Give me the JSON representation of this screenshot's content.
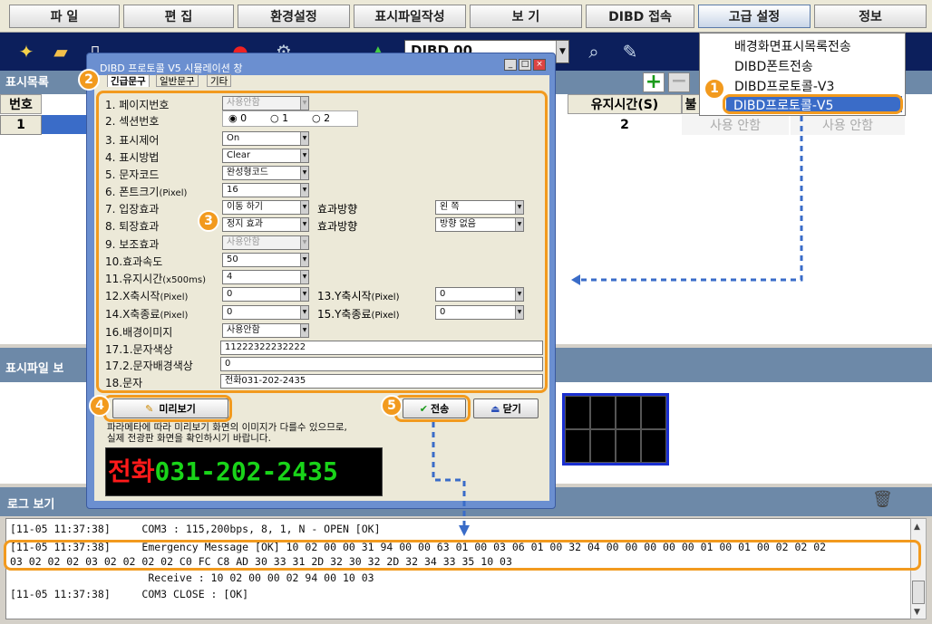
{
  "menubar": [
    "파 일",
    "편 집",
    "환경설정",
    "표시파일작성",
    "보 기",
    "DIBD 접속",
    "고급 설정",
    "정보"
  ],
  "toolbar": {
    "combo_value": "DIBD 00"
  },
  "list": {
    "title": "표시목록",
    "col_no": "번호",
    "col_hold": "유지시간(S)",
    "col_trunc": "불",
    "row_no": "1",
    "row_hold": "2",
    "unused_1": "사용 안함",
    "unused_2": "사용 안함"
  },
  "advanced_menu": [
    "배경화면표시목록전송",
    "DIBD폰트전송",
    "DIBD프로토콜-V3",
    "DIBD프로토콜-V5"
  ],
  "dialog": {
    "title": "DIBD 프로토콜 V5 시뮬레이션 창",
    "tabs": [
      "긴급문구",
      "일반문구",
      "기타"
    ],
    "labels": {
      "page": "1. 페이지번호",
      "section": "2. 섹션번호",
      "display_control": "3. 표시제어",
      "display_method": "4. 표시방법",
      "char_code": "5. 문자코드",
      "font_size": "6. 폰트크기",
      "font_size_unit": "(Pixel)",
      "enter_effect": "7. 입장효과",
      "exit_effect": "8. 퇴장효과",
      "aux_effect": "9. 보조효과",
      "effect_speed": "10.효과속도",
      "hold_time": "11.유지시간",
      "hold_unit": "(x500ms)",
      "x_start": "12.X축시작",
      "x_end": "14.X축종료",
      "px": "(Pixel)",
      "y_start": "13.Y축시작",
      "y_end": "15.Y축종료",
      "bg_image": "16.배경이미지",
      "text_color": "17.1.문자색상",
      "text_bg_color": "17.2.문자배경색상",
      "text": "18.문자",
      "effect_dir": "효과방향"
    },
    "values": {
      "page": "사용안함",
      "display_control": "On",
      "display_method": "Clear",
      "char_code": "완성형코드",
      "font_size": "16",
      "enter_effect": "이동 하기",
      "enter_dir": "왼     쪽",
      "exit_effect": "정지 효과",
      "exit_dir": "방향 없음",
      "aux_effect": "사용안함",
      "effect_speed": "50",
      "hold_time": "4",
      "x_start": "0",
      "x_end": "0",
      "y_start": "0",
      "y_end": "0",
      "bg_image": "사용안함",
      "text_color": "11222322232222",
      "text_bg_color": "0",
      "text": "전화031-202-2435"
    },
    "section_radios": [
      "0",
      "1",
      "2"
    ],
    "preview_button": "미리보기",
    "send_button": "전송",
    "close_button": "닫기",
    "notice_line1": "파라메타에 따라 미리보기 화면의 이미지가 다를수 있으므로,",
    "notice_line2": "실제 전광판 화면을 확인하시기 바랍니다.",
    "led_red": "전화",
    "led_green": "031-202-2435"
  },
  "preview_section": {
    "title": "표시파일 보"
  },
  "log": {
    "title": "로그 보기",
    "lines": [
      "[11-05 11:37:38]     COM3 : 115,200bps, 8, 1, N - OPEN [OK]",
      "[11-05 11:37:38]     Emergency Message [OK] 10 02 00 00 31 94 00 00 63 01 00 03 06 01 00 32 04 00 00 00 00 00 01 00 01 00 02 02 02",
      "03 02 02 02 03 02 02 02 02 C0 FC C8 AD 30 33 31 2D 32 30 32 2D 32 34 33 35 10 03",
      "                      Receive : 10 02 00 00 02 94 00 10 03",
      "[11-05 11:37:38]     COM3 CLOSE : [OK]"
    ]
  },
  "steps": [
    "1",
    "2",
    "3",
    "4",
    "5"
  ],
  "colors": {
    "highlight": "#f29a1e",
    "arrow": "#3a6cc8",
    "title_blue": "#6d89a8",
    "led_red": "#ff1a1a",
    "led_green": "#19d419"
  }
}
